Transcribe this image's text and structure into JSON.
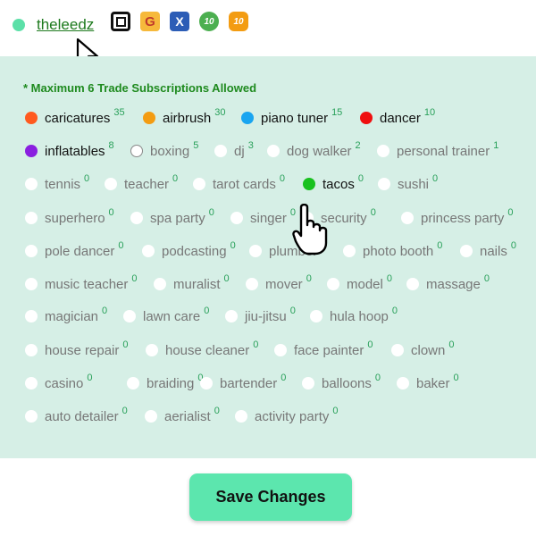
{
  "user": {
    "username": "theleedz"
  },
  "badges": [
    "square-badge-icon",
    "g-badge-icon",
    "x-badge-icon",
    "ten-badge-green-icon",
    "ten-badge-orange-icon"
  ],
  "panel": {
    "title": "* Maximum 6 Trade Subscriptions Allowed"
  },
  "trades": [
    {
      "label": "caricatures",
      "count": "35",
      "color": "#ff5a1f",
      "active": true
    },
    {
      "label": "airbrush",
      "count": "30",
      "color": "#f39c12",
      "active": true
    },
    {
      "label": "piano tuner",
      "count": "15",
      "color": "#1aa5f0",
      "active": true
    },
    {
      "label": "dancer",
      "count": "10",
      "color": "#ef0f0f",
      "active": true
    },
    {
      "label": "inflatables",
      "count": "8",
      "color": "#8a1fe0",
      "active": true
    },
    {
      "label": "boxing",
      "count": "5",
      "color": "",
      "active": false
    },
    {
      "label": "dj",
      "count": "3",
      "color": "",
      "active": false
    },
    {
      "label": "dog walker",
      "count": "2",
      "color": "",
      "active": false
    },
    {
      "label": "personal trainer",
      "count": "1",
      "color": "",
      "active": false
    },
    {
      "label": "tennis",
      "count": "0",
      "color": "",
      "active": false
    },
    {
      "label": "teacher",
      "count": "0",
      "color": "",
      "active": false
    },
    {
      "label": "tarot cards",
      "count": "0",
      "color": "",
      "active": false
    },
    {
      "label": "tacos",
      "count": "0",
      "color": "#19c11f",
      "active": true
    },
    {
      "label": "sushi",
      "count": "0",
      "color": "",
      "active": false
    },
    {
      "label": "superhero",
      "count": "0",
      "color": "",
      "active": false
    },
    {
      "label": "spa party",
      "count": "0",
      "color": "",
      "active": false
    },
    {
      "label": "singer",
      "count": "0",
      "color": "",
      "active": false
    },
    {
      "label": "security",
      "count": "0",
      "color": "",
      "active": false
    },
    {
      "label": "princess party",
      "count": "0",
      "color": "",
      "active": false
    },
    {
      "label": "pole dancer",
      "count": "0",
      "color": "",
      "active": false
    },
    {
      "label": "podcasting",
      "count": "0",
      "color": "",
      "active": false
    },
    {
      "label": "plumber",
      "count": "0",
      "color": "",
      "active": false
    },
    {
      "label": "photo booth",
      "count": "0",
      "color": "",
      "active": false
    },
    {
      "label": "nails",
      "count": "0",
      "color": "",
      "active": false
    },
    {
      "label": "music teacher",
      "count": "0",
      "color": "",
      "active": false
    },
    {
      "label": "muralist",
      "count": "0",
      "color": "",
      "active": false
    },
    {
      "label": "mover",
      "count": "0",
      "color": "",
      "active": false
    },
    {
      "label": "model",
      "count": "0",
      "color": "",
      "active": false
    },
    {
      "label": "massage",
      "count": "0",
      "color": "",
      "active": false
    },
    {
      "label": "magician",
      "count": "0",
      "color": "",
      "active": false
    },
    {
      "label": "lawn care",
      "count": "0",
      "color": "",
      "active": false
    },
    {
      "label": "jiu-jitsu",
      "count": "0",
      "color": "",
      "active": false
    },
    {
      "label": "hula hoop",
      "count": "0",
      "color": "",
      "active": false
    },
    {
      "label": "house repair",
      "count": "0",
      "color": "",
      "active": false
    },
    {
      "label": "house cleaner",
      "count": "0",
      "color": "",
      "active": false
    },
    {
      "label": "face painter",
      "count": "0",
      "color": "",
      "active": false
    },
    {
      "label": "clown",
      "count": "0",
      "color": "",
      "active": false
    },
    {
      "label": "casino",
      "count": "0",
      "color": "",
      "active": false
    },
    {
      "label": "braiding",
      "count": "0",
      "color": "",
      "active": false
    },
    {
      "label": "bartender",
      "count": "0",
      "color": "",
      "active": false
    },
    {
      "label": "balloons",
      "count": "0",
      "color": "",
      "active": false
    },
    {
      "label": "baker",
      "count": "0",
      "color": "",
      "active": false
    },
    {
      "label": "auto detailer",
      "count": "0",
      "color": "",
      "active": false
    },
    {
      "label": "aerialist",
      "count": "0",
      "color": "",
      "active": false
    },
    {
      "label": "activity party",
      "count": "0",
      "color": "",
      "active": false
    }
  ],
  "actions": {
    "save_label": "Save Changes"
  }
}
